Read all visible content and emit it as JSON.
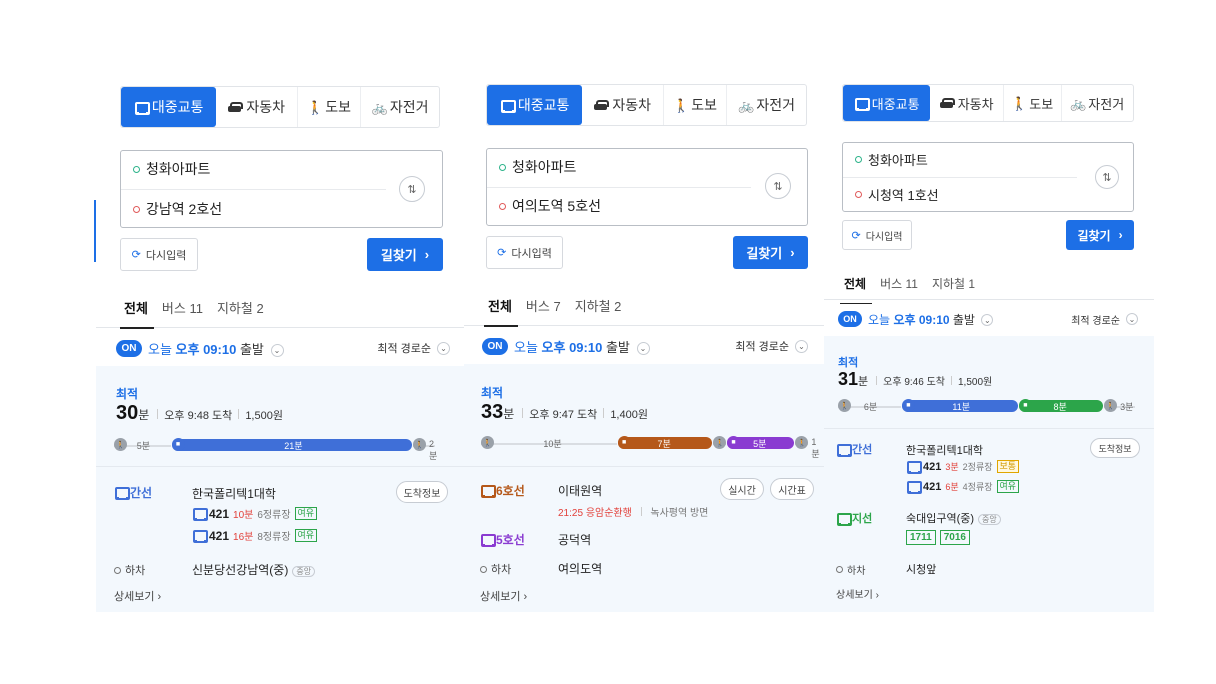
{
  "colors": {
    "accent": "#1d6fe6",
    "bus_blue": "#3f6fd8",
    "line6_brown": "#b5581a",
    "line5_purple": "#8a3bd1",
    "trunk_green": "#2ca54a"
  },
  "panels": [
    {
      "modes": {
        "transit": "대중교통",
        "car": "자동차",
        "walk": "도보",
        "bike": "자전거"
      },
      "origin": "청화아파트",
      "destination": "강남역 2호선",
      "reset_label": "다시입력",
      "find_label": "길찾기",
      "tabs": {
        "all": "전체",
        "bus": "버스 11",
        "subway": "지하철 2"
      },
      "on_label": "ON",
      "today": "오늘",
      "depart_time": "오후 09:10",
      "depart_suffix": "출발",
      "sort_label": "최적 경로순",
      "best_label": "최적",
      "duration_num": "30",
      "duration_unit": "분",
      "arrival": "오후 9:48 도착",
      "fare": "1,500원",
      "bar": [
        {
          "type": "walk",
          "label": "5분",
          "minutes": 5
        },
        {
          "type": "bus",
          "label": "21분",
          "minutes": 21
        },
        {
          "type": "walk",
          "label": "2분",
          "minutes": 2
        }
      ],
      "segments": {
        "line_name": "간선",
        "boarding_stop": "한국폴리텍1대학",
        "arrival_info_label": "도착정보",
        "buses": [
          {
            "number": "421",
            "eta": "10분",
            "stops": "6정류장",
            "crowd": "여유"
          },
          {
            "number": "421",
            "eta": "16분",
            "stops": "8정류장",
            "crowd": "여유"
          }
        ],
        "getoff_label": "하차",
        "getoff_stop": "신분당선강남역(중)",
        "getoff_tag": "중앙"
      },
      "more_label": "상세보기"
    },
    {
      "modes": {
        "transit": "대중교통",
        "car": "자동차",
        "walk": "도보",
        "bike": "자전거"
      },
      "origin": "청화아파트",
      "destination": "여의도역 5호선",
      "reset_label": "다시입력",
      "find_label": "길찾기",
      "tabs": {
        "all": "전체",
        "bus": "버스 7",
        "subway": "지하철 2"
      },
      "on_label": "ON",
      "today": "오늘",
      "depart_time": "오후 09:10",
      "depart_suffix": "출발",
      "sort_label": "최적 경로순",
      "best_label": "최적",
      "duration_num": "33",
      "duration_unit": "분",
      "arrival": "오후 9:47 도착",
      "fare": "1,400원",
      "bar": [
        {
          "type": "walk",
          "label": "10분",
          "minutes": 10
        },
        {
          "type": "subway6",
          "label": "7분",
          "minutes": 7
        },
        {
          "type": "walk",
          "label": "1분",
          "minutes": 1
        },
        {
          "type": "subway5",
          "label": "5분",
          "minutes": 5
        },
        {
          "type": "walk",
          "label": "1분",
          "minutes": 1
        }
      ],
      "segments": {
        "line6_name": "6호선",
        "line6_stop": "이태원역",
        "realtime_label": "실시간",
        "timetable_label": "시간표",
        "line6_detail_time": "21:25",
        "line6_detail_dir": "응암순환행",
        "line6_detail_next": "녹사평역 방면",
        "line5_name": "5호선",
        "line5_stop": "공덕역",
        "getoff_label": "하차",
        "getoff_stop": "여의도역"
      },
      "more_label": "상세보기"
    },
    {
      "modes": {
        "transit": "대중교통",
        "car": "자동차",
        "walk": "도보",
        "bike": "자전거"
      },
      "origin": "청화아파트",
      "destination": "시청역 1호선",
      "reset_label": "다시입력",
      "find_label": "길찾기",
      "tabs": {
        "all": "전체",
        "bus": "버스 11",
        "subway": "지하철 1"
      },
      "on_label": "ON",
      "today": "오늘",
      "depart_time": "오후 09:10",
      "depart_suffix": "출발",
      "sort_label": "최적 경로순",
      "best_label": "최적",
      "duration_num": "31",
      "duration_unit": "분",
      "arrival": "오후 9:46 도착",
      "fare": "1,500원",
      "bar": [
        {
          "type": "walk",
          "label": "6분",
          "minutes": 6
        },
        {
          "type": "bus",
          "label": "11분",
          "minutes": 11
        },
        {
          "type": "trunk",
          "label": "8분",
          "minutes": 8
        },
        {
          "type": "walk",
          "label": "3분",
          "minutes": 3
        }
      ],
      "segments": {
        "line_name": "간선",
        "boarding_stop": "한국폴리텍1대학",
        "arrival_info_label": "도착정보",
        "buses": [
          {
            "number": "421",
            "eta": "3분",
            "stops": "2정류장",
            "crowd": "보통"
          },
          {
            "number": "421",
            "eta": "6분",
            "stops": "4정류장",
            "crowd": "여유"
          }
        ],
        "branch_name": "지선",
        "branch_stop": "숙대입구역(중)",
        "branch_tag": "중앙",
        "branch_buses": [
          "1711",
          "7016"
        ],
        "getoff_label": "하차",
        "getoff_stop": "시청앞"
      },
      "more_label": "상세보기"
    }
  ]
}
